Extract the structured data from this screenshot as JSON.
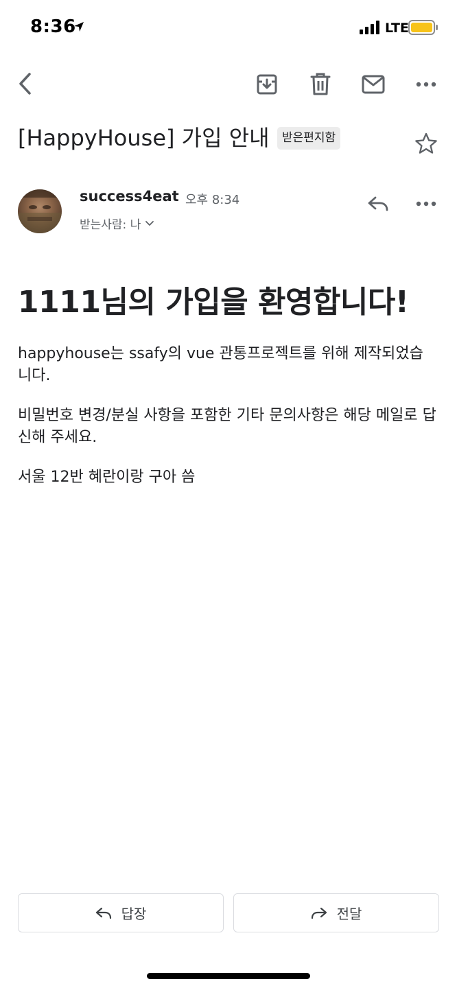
{
  "status_bar": {
    "time": "8:36",
    "network": "LTE",
    "battery_color": "#f7c31a"
  },
  "toolbar": {
    "back_icon": "chevron-left-icon",
    "archive_icon": "archive-icon",
    "delete_icon": "trash-icon",
    "mark_unread_icon": "mail-icon",
    "more_icon": "more-horizontal-icon"
  },
  "email": {
    "subject": "[HappyHouse] 가입 안내",
    "label": "받은편지함",
    "starred": false,
    "sender": "success4eat",
    "time": "오후 8:34",
    "recipient": "받는사람: 나",
    "heading": "1111님의 가입을 환영합니다!",
    "paragraphs": [
      "happyhouse는 ssafy의 vue 관통프로젝트를 위해 제작되었습니다.",
      "비밀번호 변경/분실 사항을 포함한 기타 문의사항은 해당 메일로 답신해 주세요.",
      "서울 12반 혜란이랑 구아 씀"
    ]
  },
  "actions": {
    "reply_label": "답장",
    "forward_label": "전달"
  }
}
